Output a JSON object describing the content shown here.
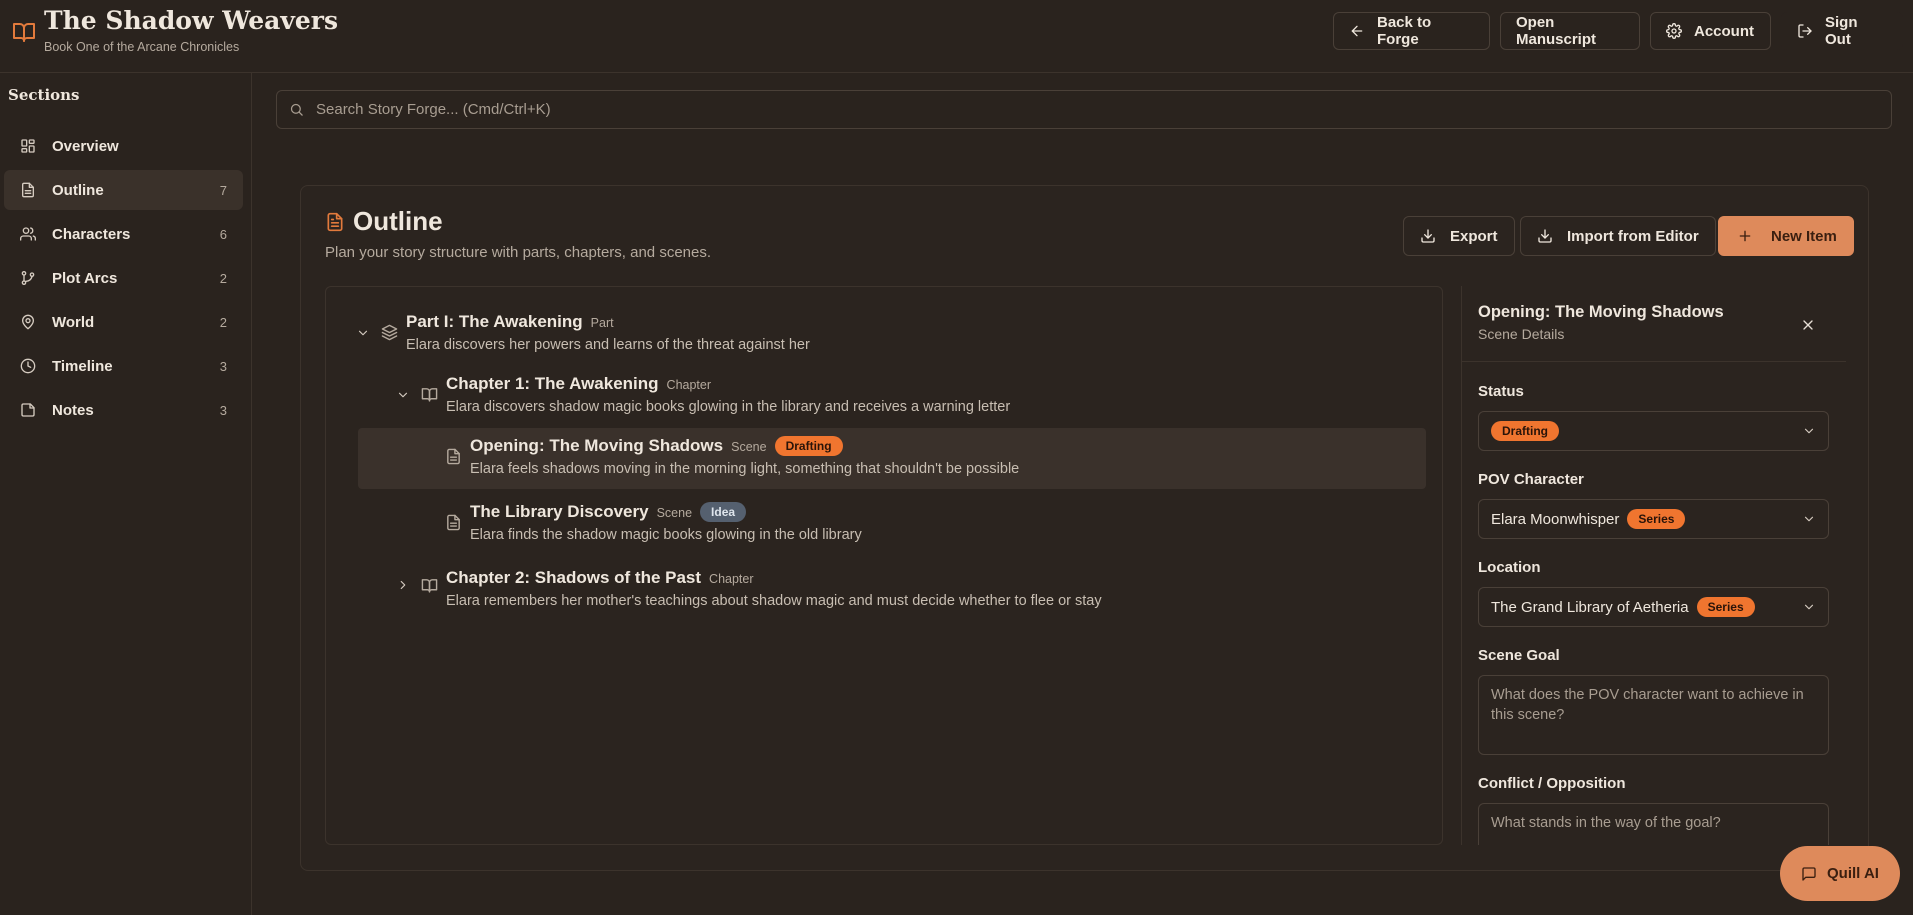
{
  "header": {
    "title": "The Shadow Weavers",
    "subtitle": "Book One of the Arcane Chronicles",
    "buttons": {
      "back": "Back to Forge",
      "manuscript": "Open Manuscript",
      "account": "Account",
      "signout": "Sign Out"
    }
  },
  "sidebar": {
    "title": "Sections",
    "items": [
      {
        "label": "Overview",
        "count": "",
        "icon": "grid-icon"
      },
      {
        "label": "Outline",
        "count": "7",
        "icon": "file-text-icon"
      },
      {
        "label": "Characters",
        "count": "6",
        "icon": "users-icon"
      },
      {
        "label": "Plot Arcs",
        "count": "2",
        "icon": "git-branch-icon"
      },
      {
        "label": "World",
        "count": "2",
        "icon": "map-pin-icon"
      },
      {
        "label": "Timeline",
        "count": "3",
        "icon": "clock-icon"
      },
      {
        "label": "Notes",
        "count": "3",
        "icon": "sticky-note-icon"
      }
    ]
  },
  "search": {
    "placeholder": "Search Story Forge... (Cmd/Ctrl+K)"
  },
  "outline": {
    "title": "Outline",
    "subtitle": "Plan your story structure with parts, chapters, and scenes.",
    "buttons": {
      "export": "Export",
      "import": "Import from Editor",
      "new": "New Item"
    },
    "tree": {
      "part": {
        "title": "Part I: The Awakening",
        "type": "Part",
        "desc": "Elara discovers her powers and learns of the threat against her"
      },
      "chapter1": {
        "title": "Chapter 1: The Awakening",
        "type": "Chapter",
        "desc": "Elara discovers shadow magic books glowing in the library and receives a warning letter"
      },
      "scene1": {
        "title": "Opening: The Moving Shadows",
        "type": "Scene",
        "status": "Drafting",
        "desc": "Elara feels shadows moving in the morning light, something that shouldn't be possible"
      },
      "scene2": {
        "title": "The Library Discovery",
        "type": "Scene",
        "status": "Idea",
        "desc": "Elara finds the shadow magic books glowing in the old library"
      },
      "chapter2": {
        "title": "Chapter 2: Shadows of the Past",
        "type": "Chapter",
        "desc": "Elara remembers her mother's teachings about shadow magic and must decide whether to flee or stay"
      }
    }
  },
  "detail": {
    "title": "Opening: The Moving Shadows",
    "subtitle": "Scene Details",
    "status_label": "Status",
    "status_value": "Drafting",
    "pov_label": "POV Character",
    "pov_value": "Elara Moonwhisper",
    "pov_badge": "Series",
    "location_label": "Location",
    "location_value": "The Grand Library of Aetheria",
    "location_badge": "Series",
    "goal_label": "Scene Goal",
    "goal_placeholder": "What does the POV character want to achieve in this scene?",
    "conflict_label": "Conflict / Opposition",
    "conflict_placeholder": "What stands in the way of the goal?"
  },
  "quill": {
    "label": "Quill AI"
  },
  "colors": {
    "accent": "#de8a5b",
    "badge_orange": "#f0752f",
    "badge_slate": "#55606f",
    "background": "#2a231e"
  }
}
